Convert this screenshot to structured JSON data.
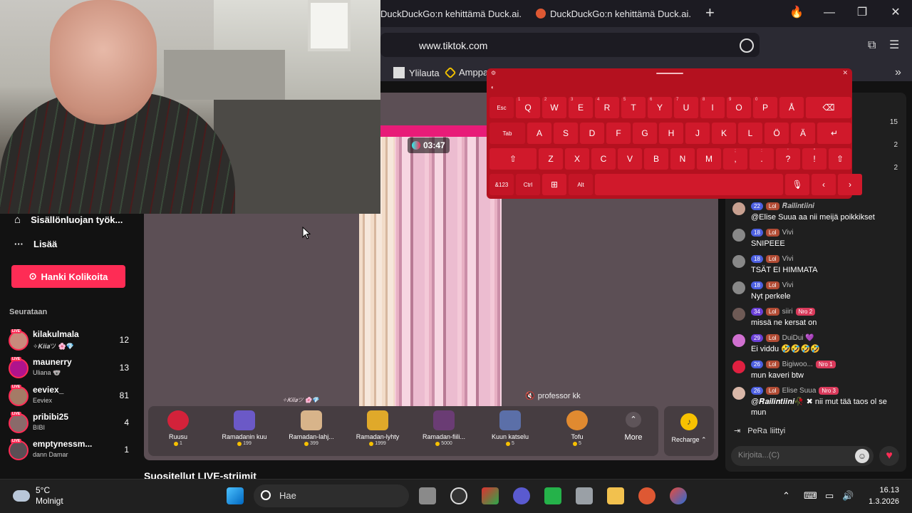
{
  "browser": {
    "tabs": [
      {
        "label": "DuckDuckGo:n kehittämä Duck.ai."
      },
      {
        "label": "DuckDuckGo:n kehittämä Duck.ai."
      }
    ],
    "url": "www.tiktok.com",
    "bookmarks": [
      {
        "label": "Ylilauta"
      },
      {
        "label": "Amppa"
      }
    ]
  },
  "sidebar": {
    "items": [
      {
        "label": "Sisällönluojan työk..."
      },
      {
        "label": "Lisää"
      }
    ],
    "coins_button": "Hanki Kolikoita",
    "following_title": "Seurataan",
    "live_badge": "LIVE",
    "following": [
      {
        "name": "kilakulmala",
        "sub": "✧𝑲𝒊𝒊𝒂ツ 🌸💎",
        "count": "12",
        "color": "#c98a7c"
      },
      {
        "name": "maunerry",
        "sub": "Uliana 🐨",
        "count": "13",
        "color": "#b0138c"
      },
      {
        "name": "eeviex_",
        "sub": "Eeviex",
        "count": "81",
        "color": "#a47b66"
      },
      {
        "name": "pribibi25",
        "sub": "BIBI",
        "count": "4",
        "color": "#8a6a6a"
      },
      {
        "name": "emptynessm...",
        "sub": "dann Damar",
        "count": "1",
        "color": "#5a4f55"
      }
    ]
  },
  "player": {
    "timer": "03:47",
    "watermark": "✧𝑲𝒊𝒊𝒂ツ 🌸💎",
    "professor": "professor kk",
    "gifts": [
      {
        "name": "Ruusu",
        "price": "1",
        "color": "#d3223a"
      },
      {
        "name": "Ramadanin kuu",
        "price": "199",
        "color": "#6b59c7"
      },
      {
        "name": "Ramadan-lahj...",
        "price": "399",
        "color": "#d8b48a"
      },
      {
        "name": "Ramadan-lyhty",
        "price": "1999",
        "color": "#e0a92a"
      },
      {
        "name": "Ramadan-fiili...",
        "price": "5000",
        "color": "#6a3c74"
      },
      {
        "name": "Kuun katselu",
        "price": "5",
        "color": "#5b6fa8"
      },
      {
        "name": "Tofu",
        "price": "5",
        "color": "#e08a30"
      }
    ],
    "more_label": "More",
    "recharge_label": "Recharge ⌃"
  },
  "recommended_title": "Suositellut LIVE-striimit",
  "chat": {
    "viewer_counts": [
      "15",
      "2",
      "2"
    ],
    "messages": [
      {
        "level": "22",
        "user": "𝑹𝒂𝒊𝒍𝒊𝒏𝒕𝒊𝒊𝒏𝒊",
        "text": "@Elise Suua aa nii meijä poikkikset",
        "lol": "Lol",
        "nro": "",
        "av": "#c8a090",
        "purple": false
      },
      {
        "level": "18",
        "user": "Vivi",
        "text": "SNIPEEE",
        "lol": "Lol",
        "nro": "",
        "av": "#888888",
        "purple": false
      },
      {
        "level": "18",
        "user": "Vivi",
        "text": "TSÄT EI HIMMATA",
        "lol": "Lol",
        "nro": "",
        "av": "#888888",
        "purple": false
      },
      {
        "level": "18",
        "user": "Vivi",
        "text": "Nyt perkele",
        "lol": "Lol",
        "nro": "",
        "av": "#888888",
        "purple": false
      },
      {
        "level": "34",
        "user": "siiri",
        "text": "missä ne kersat on",
        "lol": "Lol",
        "nro": "Nro 2",
        "av": "#6e5a55",
        "purple": true
      },
      {
        "level": "29",
        "user": "DuiDui 💜",
        "text": "Ei viddu 🤣🤣🤣🤣",
        "lol": "Lol",
        "nro": "",
        "av": "#d070d0",
        "purple": true
      },
      {
        "level": "26",
        "user": "Bigiwoo...",
        "text": "mun kaveri btw",
        "lol": "Lol",
        "nro": "Nro 1",
        "av": "#e02040",
        "purple": false
      },
      {
        "level": "26",
        "user": "Elise Suua",
        "text": "@𝑹𝒂𝒊𝒍𝒊𝒏𝒕𝒊𝒊𝒏𝒊🥀 ✖ nii mut tää taos ol se mun",
        "lol": "Lol",
        "nro": "Nro 3",
        "av": "#d9b7a8",
        "purple": false
      }
    ],
    "joined_user": "PeRa",
    "joined_text": "liittyi",
    "input_placeholder": "Kirjoita...(C)"
  },
  "keyboard": {
    "row1": [
      "Esc",
      "Q",
      "W",
      "E",
      "R",
      "T",
      "Y",
      "U",
      "I",
      "O",
      "P",
      "Å",
      "⌫"
    ],
    "row1_nums": [
      "",
      "1",
      "2",
      "3",
      "4",
      "5",
      "6",
      "7",
      "8",
      "9",
      "0",
      "",
      ""
    ],
    "row2": [
      "Tab",
      "A",
      "S",
      "D",
      "F",
      "G",
      "H",
      "J",
      "K",
      "L",
      "Ö",
      "Ä",
      "↵"
    ],
    "row3": [
      "⇧",
      "Z",
      "X",
      "C",
      "V",
      "B",
      "N",
      "M",
      ",",
      ".",
      "?",
      "!",
      "⇧"
    ],
    "row3_syms": [
      "",
      "",
      "",
      "",
      "",
      "",
      "",
      "",
      ";",
      ":",
      "'",
      "\"",
      ""
    ],
    "row4": [
      "&123",
      "Ctrl",
      "⊞",
      "Alt",
      "",
      "🎙",
      "‹",
      "›"
    ]
  },
  "taskbar": {
    "temp": "5°C",
    "weather": "Molnigt",
    "search": "Hae",
    "time": "16.13",
    "date": "1.3.2026"
  }
}
